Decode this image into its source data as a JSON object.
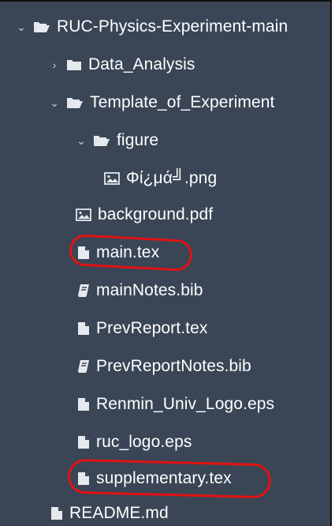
{
  "file_tree": {
    "items": [
      {
        "name": "root",
        "label": "RUC-Physics-Experiment-main",
        "type": "folder",
        "expanded": true,
        "icon": "folder-open-icon"
      },
      {
        "name": "data-analysis",
        "label": "Data_Analysis",
        "type": "folder",
        "expanded": false,
        "icon": "folder-closed-icon"
      },
      {
        "name": "template",
        "label": "Template_of_Experiment",
        "type": "folder",
        "expanded": true,
        "icon": "folder-open-icon"
      },
      {
        "name": "figure",
        "label": "figure",
        "type": "folder",
        "expanded": true,
        "icon": "folder-open-icon"
      },
      {
        "name": "image-png",
        "label": "Φί¿μά╝.png",
        "type": "image",
        "icon": "image-file-icon"
      },
      {
        "name": "background-pdf",
        "label": "background.pdf",
        "type": "image",
        "icon": "image-file-icon"
      },
      {
        "name": "main-tex",
        "label": "main.tex",
        "type": "file",
        "icon": "file-icon",
        "circled": true
      },
      {
        "name": "mainnotes-bib",
        "label": "mainNotes.bib",
        "type": "bib",
        "icon": "book-icon"
      },
      {
        "name": "prevreport-tex",
        "label": "PrevReport.tex",
        "type": "file",
        "icon": "file-icon"
      },
      {
        "name": "prevreportnotes-bib",
        "label": "PrevReportNotes.bib",
        "type": "bib",
        "icon": "book-icon"
      },
      {
        "name": "renmin-logo-eps",
        "label": "Renmin_Univ_Logo.eps",
        "type": "file",
        "icon": "file-icon"
      },
      {
        "name": "ruc-logo-eps",
        "label": "ruc_logo.eps",
        "type": "file",
        "icon": "file-icon"
      },
      {
        "name": "supplementary-tex",
        "label": "supplementary.tex",
        "type": "file",
        "icon": "file-icon",
        "circled": true
      },
      {
        "name": "readme-md",
        "label": "README.md",
        "type": "file",
        "icon": "file-icon"
      }
    ]
  },
  "colors": {
    "panel_bg": "#3a4656",
    "text": "#ffffff",
    "annotation": "#e31212"
  }
}
